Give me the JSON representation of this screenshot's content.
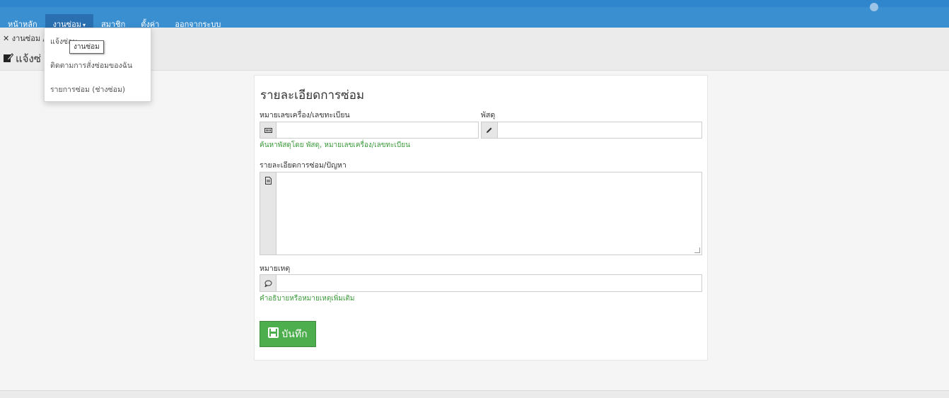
{
  "nav": {
    "items": [
      {
        "label": "หน้าหลัก"
      },
      {
        "label": "งานซ่อม",
        "caret": "▾"
      },
      {
        "label": "สมาชิก"
      },
      {
        "label": "ตั้งค่า"
      },
      {
        "label": "ออกจากระบบ"
      }
    ]
  },
  "breadcrumb": {
    "icon": "wrench-icon",
    "text": "งานซ่อม /"
  },
  "page": {
    "title": "แจ้งซ่",
    "icon": "edit-icon"
  },
  "dropdown": {
    "items": [
      {
        "label": "แจ้งซ่อม"
      },
      {
        "label": "ติดตามการสั่งซ่อมของฉัน"
      },
      {
        "label": "รายการซ่อม (ช่างซ่อม)"
      }
    ]
  },
  "tooltip": {
    "text": "งานซ่อม"
  },
  "form": {
    "title": "รายละเอียดการซ่อม",
    "device": {
      "label": "หมายเลขเครื่อง/เลขทะเบียน",
      "value": "",
      "help": "ค้นหาพัสดุโดย พัสดุ, หมายเลขเครื่อง/เลขทะเบียน",
      "icon": "barcode-icon"
    },
    "parcel": {
      "label": "พัสดุ",
      "value": "",
      "icon": "pencil-icon"
    },
    "detail": {
      "label": "รายละเอียดการซ่อม/ปัญหา",
      "value": "",
      "icon": "file-icon"
    },
    "note": {
      "label": "หมายเหตุ",
      "value": "",
      "help": "คำอธิบายหรือหมายเหตุเพิ่มเติม",
      "icon": "comment-icon"
    },
    "save_label": "บันทึก"
  },
  "colors": {
    "nav_bg": "#3a8fd0",
    "nav_active": "#2a6fb0",
    "success": "#4cae4c",
    "help": "#3c9a3c"
  }
}
